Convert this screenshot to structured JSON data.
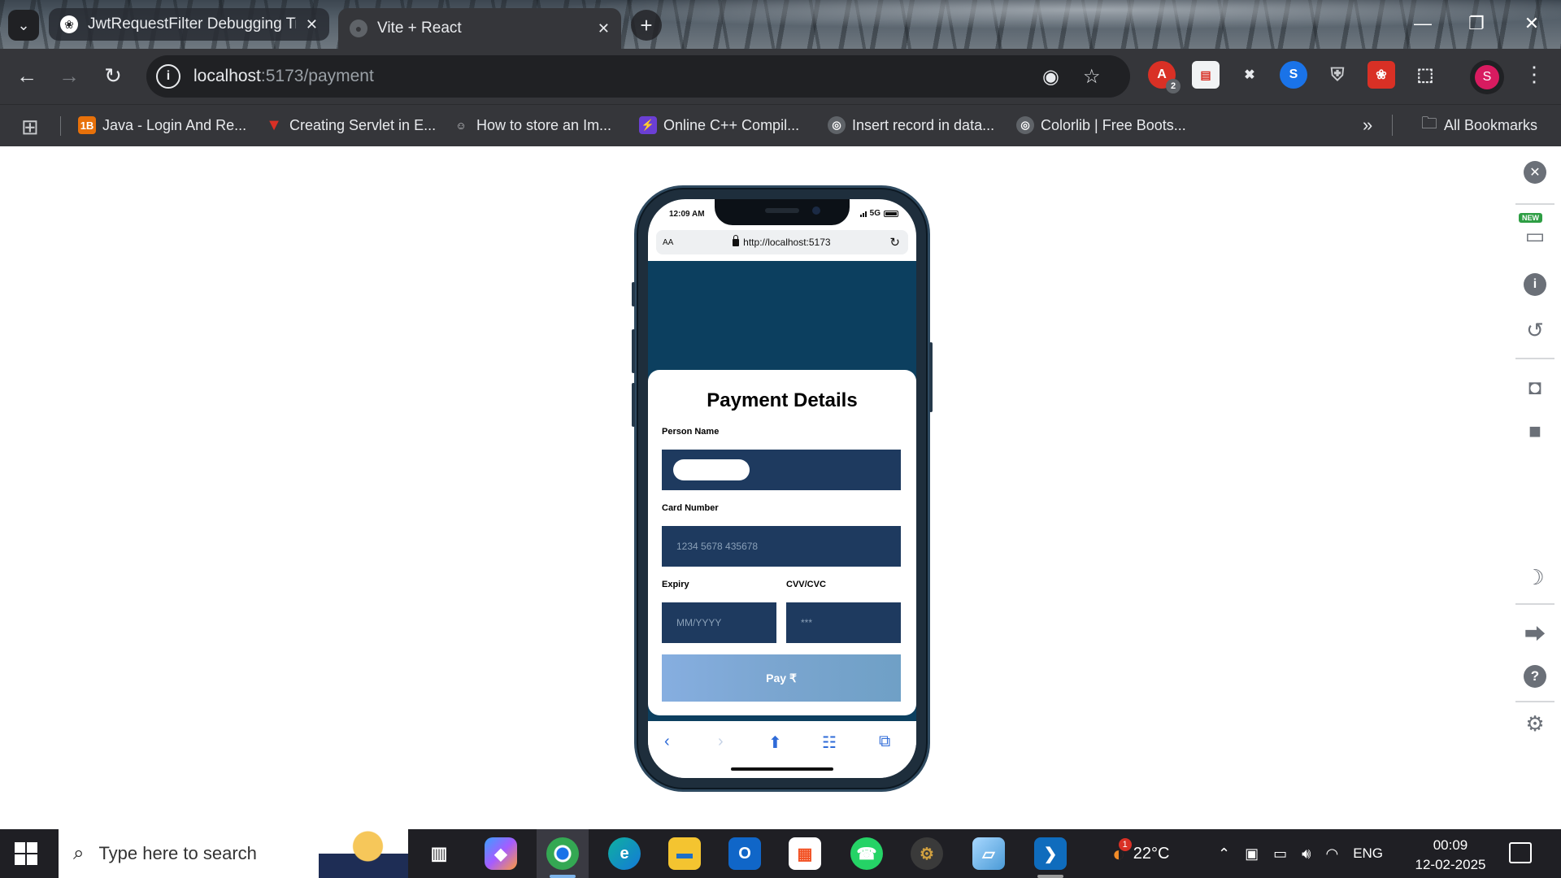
{
  "browser": {
    "tabs": [
      {
        "title": "JwtRequestFilter Debugging Tip",
        "active": false,
        "icon": "openai-icon"
      },
      {
        "title": "Vite + React",
        "active": true,
        "icon": "globe-icon"
      }
    ],
    "url": {
      "host": "localhost",
      "path": ":5173/payment"
    },
    "extension_badge": "2",
    "profile_initial": "S",
    "bookmarks": [
      {
        "label": "Java - Login And Re...",
        "icon": "1B"
      },
      {
        "label": "Creating Servlet in E...",
        "icon": "V"
      },
      {
        "label": "How to store an Im...",
        "icon": "user"
      },
      {
        "label": "Online C++ Compil...",
        "icon": "bolt"
      },
      {
        "label": "Insert record in data...",
        "icon": "globe"
      },
      {
        "label": "Colorlib | Free Boots...",
        "icon": "globe"
      }
    ],
    "all_bookmarks": "All Bookmarks"
  },
  "phone": {
    "status_time": "12:09 AM",
    "network": "5G",
    "safari_aa": "AA",
    "safari_url": "http://localhost:5173"
  },
  "payment": {
    "title": "Payment Details",
    "person_name_label": "Person Name",
    "card_number_label": "Card Number",
    "card_number_placeholder": "1234 5678 435678",
    "expiry_label": "Expiry",
    "expiry_placeholder": "MM/YYYY",
    "cvv_label": "CVV/CVC",
    "cvv_placeholder": "***",
    "pay_button": "Pay ₹"
  },
  "side_panel": {
    "new_badge": "NEW"
  },
  "taskbar": {
    "search_placeholder": "Type here to search",
    "weather_badge": "1",
    "temperature": "22°C",
    "language": "ENG",
    "time": "00:09",
    "date": "12-02-2025"
  },
  "colors": {
    "app_background": "#0c3f5f",
    "input_background": "#1e3a5f",
    "pay_button_gradient_start": "#86aee0",
    "pay_button_gradient_end": "#6fa0c6"
  }
}
